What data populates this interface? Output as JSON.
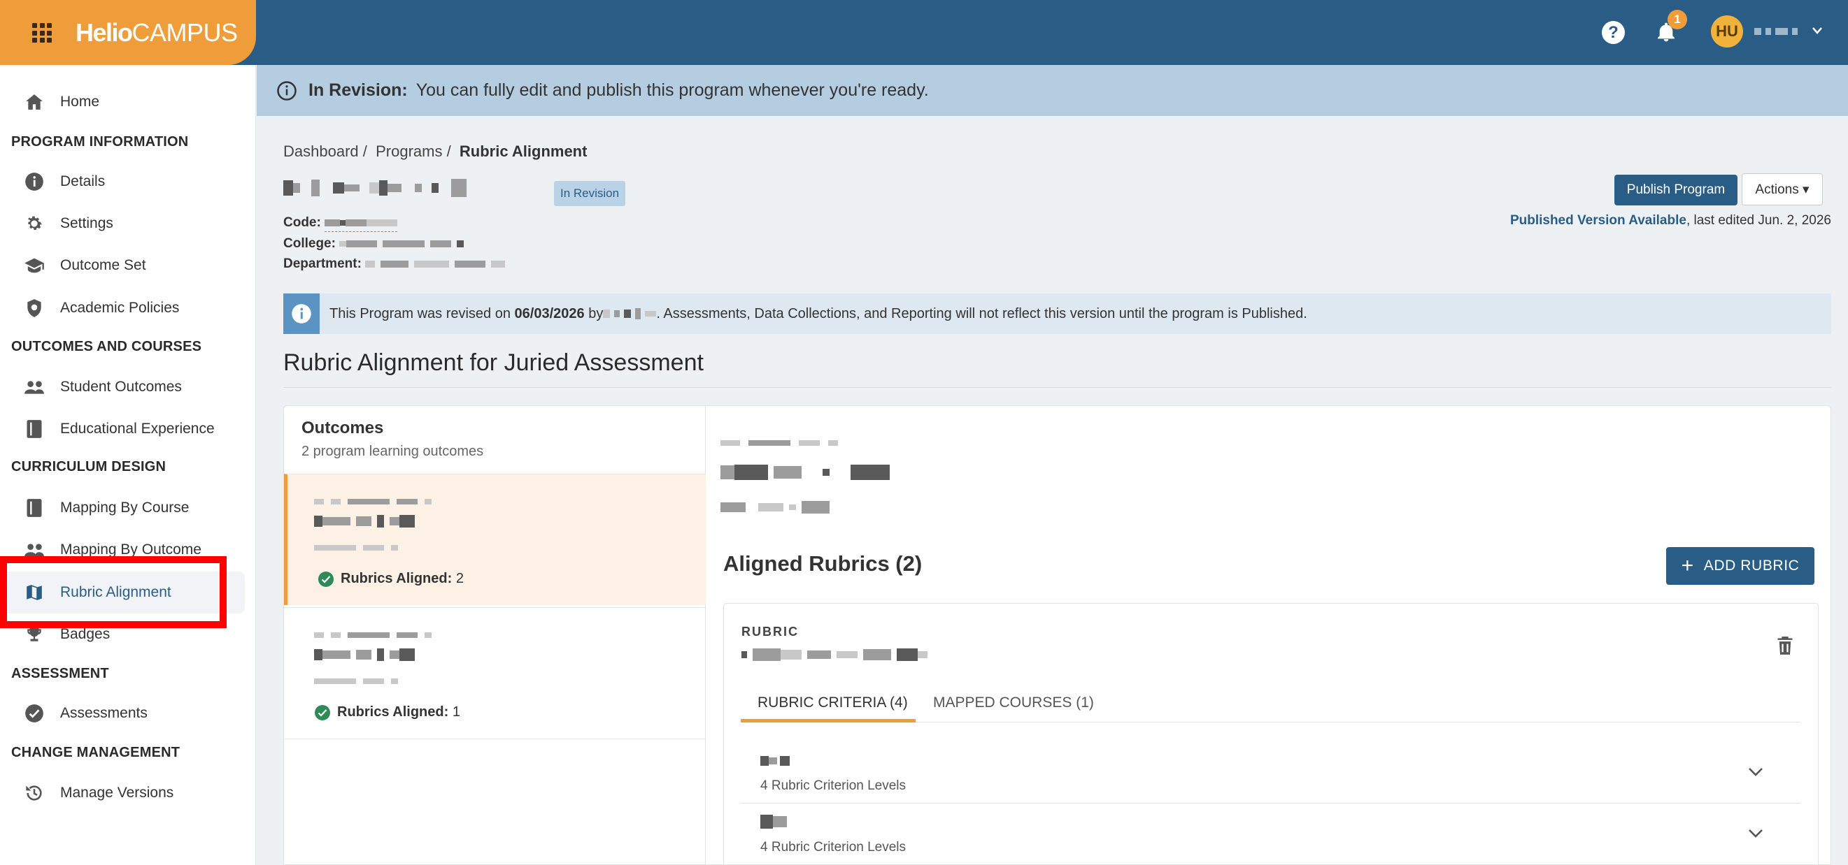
{
  "app": {
    "logo_bold": "Helio",
    "logo_light": "CAMPUS",
    "help_glyph": "?",
    "notification_count": "1",
    "user_initials": "HU"
  },
  "sidebar": {
    "home": "Home",
    "sections": [
      {
        "heading": "PROGRAM INFORMATION",
        "items": [
          "Details",
          "Settings",
          "Outcome Set",
          "Academic Policies"
        ]
      },
      {
        "heading": "OUTCOMES AND COURSES",
        "items": [
          "Student Outcomes",
          "Educational Experience"
        ]
      },
      {
        "heading": "CURRICULUM DESIGN",
        "items": [
          "Mapping By Course",
          "Mapping By Outcome",
          "Rubric Alignment",
          "Badges"
        ]
      },
      {
        "heading": "ASSESSMENT",
        "items": [
          "Assessments"
        ]
      },
      {
        "heading": "CHANGE MANAGEMENT",
        "items": [
          "Manage Versions"
        ]
      }
    ],
    "active_item": "Rubric Alignment"
  },
  "banner": {
    "label": "In Revision:",
    "text": "You can fully edit and publish this program whenever you're ready."
  },
  "breadcrumb": {
    "items": [
      "Dashboard /",
      "Programs /"
    ],
    "current": "Rubric Alignment"
  },
  "program": {
    "status_badge": "In Revision",
    "code_label": "Code:",
    "college_label": "College:",
    "department_label": "Department:"
  },
  "header_actions": {
    "publish_label": "Publish Program",
    "actions_label": "Actions",
    "published_link": "Published Version Available",
    "last_edited": ", last edited Jun. 2, 2026"
  },
  "notice": {
    "prefix": "This Program was revised on",
    "date": "06/03/2026",
    "by": "by",
    "suffix": ". Assessments, Data Collections, and Reporting will not reflect this version until the program is Published."
  },
  "page": {
    "title": "Rubric Alignment for Juried Assessment"
  },
  "outcomes": {
    "heading": "Outcomes",
    "subheading": "2 program learning outcomes",
    "aligned_label": "Rubrics Aligned:",
    "items": [
      {
        "aligned_count": "2"
      },
      {
        "aligned_count": "1"
      }
    ]
  },
  "aligned_rubrics": {
    "title": "Aligned Rubrics (2)",
    "add_label": "ADD RUBRIC",
    "rubric_label": "RUBRIC",
    "tabs": [
      "RUBRIC CRITERIA (4)",
      "MAPPED COURSES (1)"
    ],
    "criteria": [
      {
        "levels": "4 Rubric Criterion Levels"
      },
      {
        "levels": "4 Rubric Criterion Levels"
      }
    ]
  },
  "colors": {
    "brand_orange": "#ef9c3a",
    "navy": "#2a5d86",
    "banner_blue": "#b5cde0",
    "highlight_red": "#ff0000"
  }
}
